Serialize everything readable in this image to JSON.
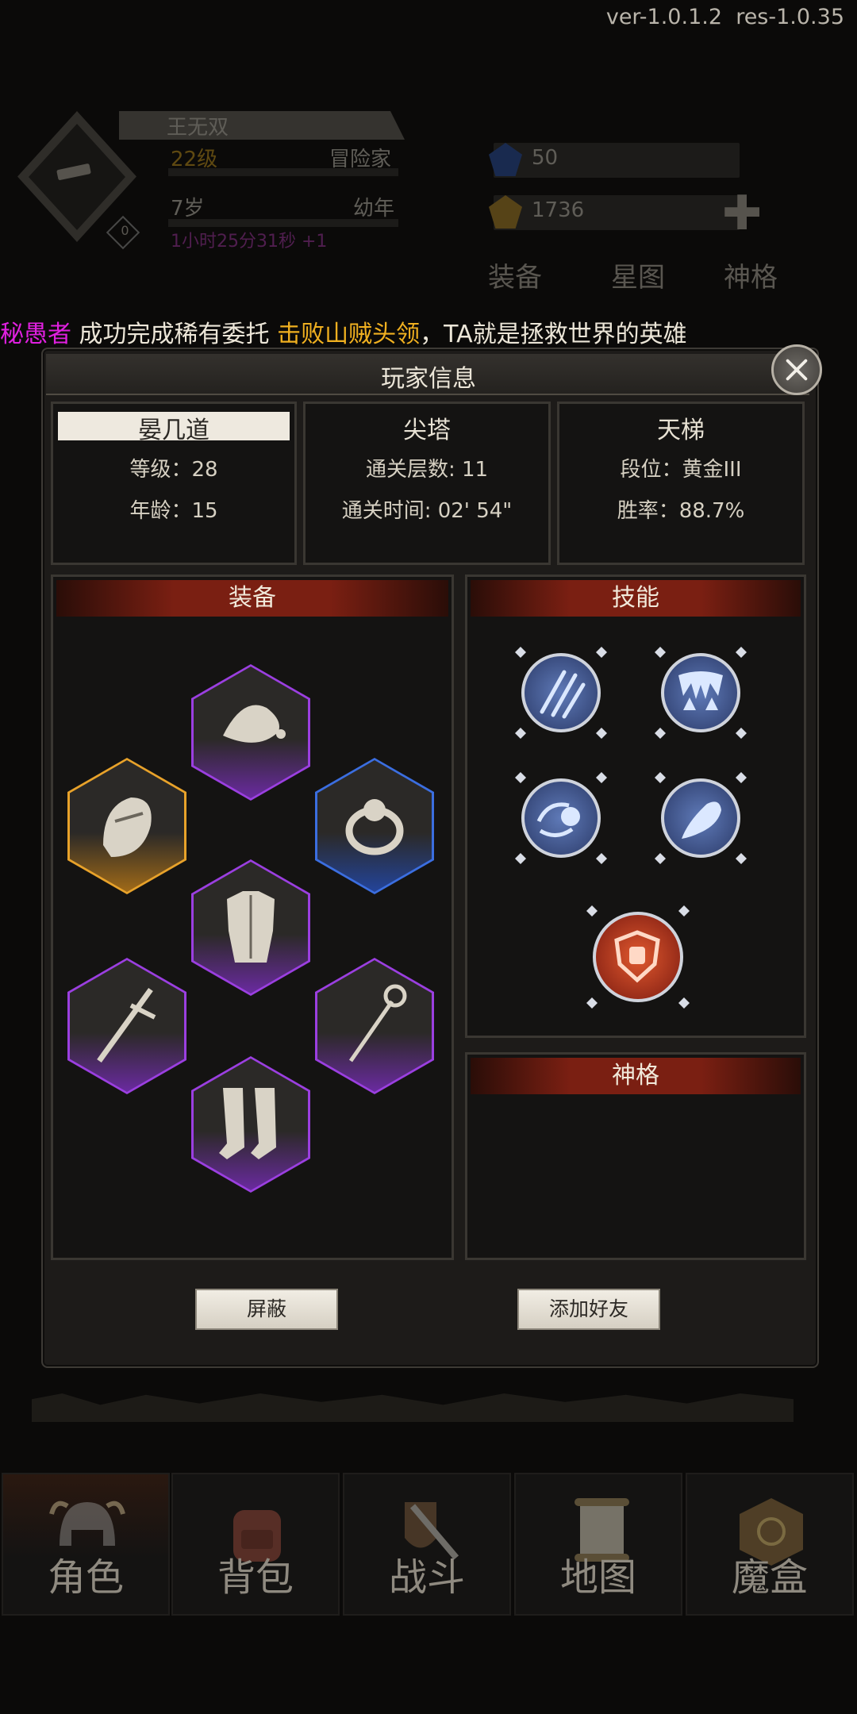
{
  "version": {
    "ver": "ver-1.0.1.2",
    "res": "res-1.0.35"
  },
  "background_header": {
    "player_name": "王无双",
    "level": "22级",
    "class": "冒险家",
    "age": "7岁",
    "stage": "幼年",
    "timer": "1小时25分31秒 +1",
    "badge": "0",
    "gems_blue": "50",
    "gems_gold": "1736",
    "tabs": [
      "装备",
      "星图",
      "神格"
    ]
  },
  "ticker": {
    "name": "秘愚者",
    "text1": " 成功完成稀有委托 ",
    "quest": "击败山贼头领",
    "text2": "，TA就是拯救世界的英雄",
    "colors": {
      "name": "#e020e0",
      "quest": "#f0b020"
    }
  },
  "panel": {
    "title": "玩家信息",
    "info": [
      {
        "title": "晏几道",
        "lines": [
          "等级：28",
          "年龄：15"
        ]
      },
      {
        "title": "尖塔",
        "lines": [
          "通关层数: 11",
          "通关时间: 02' 54\""
        ]
      },
      {
        "title": "天梯",
        "lines": [
          "段位：黄金III",
          "胜率：88.7%"
        ]
      }
    ],
    "equipment": {
      "title": "装备",
      "items": [
        {
          "name": "hat-icon",
          "rarity": "epic"
        },
        {
          "name": "helmet-icon",
          "rarity": "legendary"
        },
        {
          "name": "ring-icon",
          "rarity": "rare"
        },
        {
          "name": "armor-icon",
          "rarity": "epic"
        },
        {
          "name": "sword-icon",
          "rarity": "epic"
        },
        {
          "name": "staff-icon",
          "rarity": "epic"
        },
        {
          "name": "boots-icon",
          "rarity": "epic"
        }
      ]
    },
    "skills": {
      "title": "技能",
      "items": [
        "claw-slash-icon",
        "fangs-icon",
        "water-orb-icon",
        "fire-wisp-icon",
        "shield-fist-icon"
      ]
    },
    "divinity": {
      "title": "神格"
    },
    "buttons": {
      "block": "屏蔽",
      "add_friend": "添加好友"
    }
  },
  "nav": [
    {
      "label": "角色",
      "icon": "helmet-icon"
    },
    {
      "label": "背包",
      "icon": "backpack-icon"
    },
    {
      "label": "战斗",
      "icon": "sword-shield-icon"
    },
    {
      "label": "地图",
      "icon": "scroll-icon"
    },
    {
      "label": "魔盒",
      "icon": "magic-box-icon"
    }
  ],
  "colors": {
    "legendary": "#e8a22a",
    "rare": "#3b6ee0",
    "epic": "#9b3fe0",
    "accent_red": "#7a1f12"
  }
}
